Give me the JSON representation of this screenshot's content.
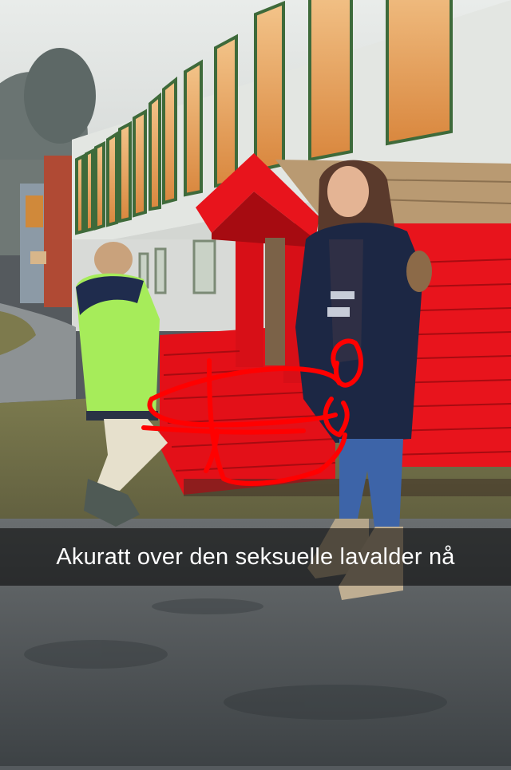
{
  "snap": {
    "caption": "Akuratt over den seksuelle lavalder nå",
    "drawing_color": "#ff0000"
  },
  "scene": {
    "playhouse_color": "#e8141c",
    "boy_jacket_color": "#a6ec5a",
    "girl_jacket_color": "#1c2744"
  }
}
